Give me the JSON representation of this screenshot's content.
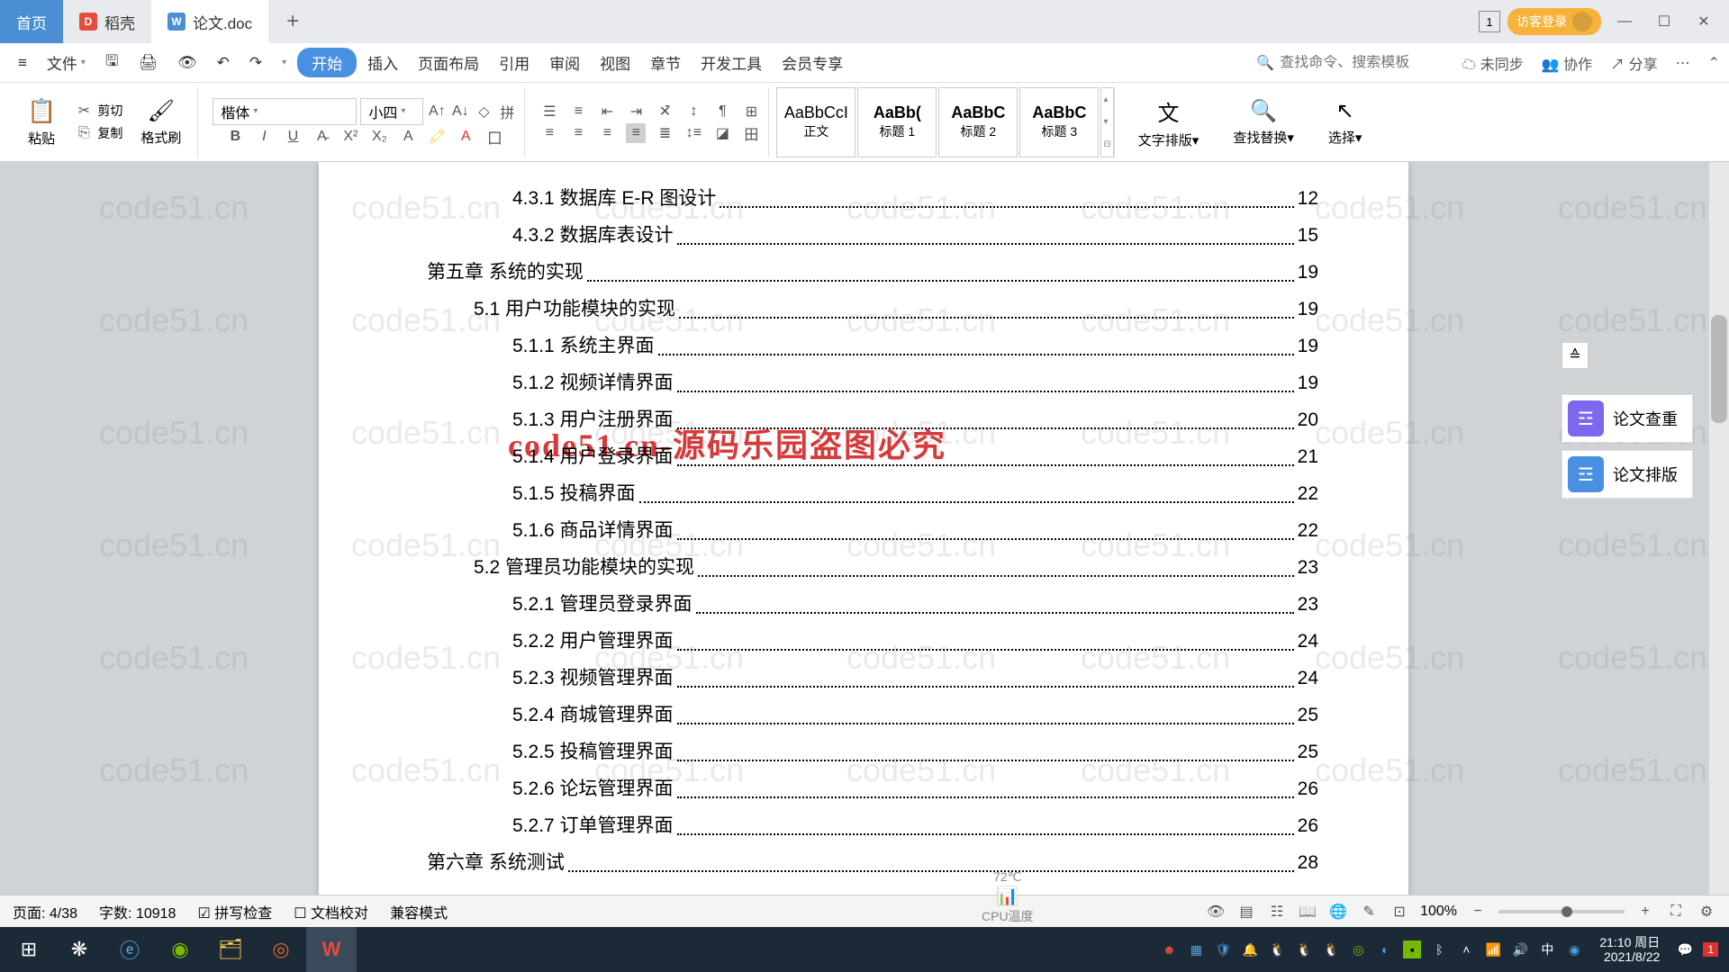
{
  "tabs": {
    "home": "首页",
    "daoke": "稻壳",
    "doc": "论文.doc"
  },
  "titlebar": {
    "box_num": "1",
    "login": "访客登录"
  },
  "menubar": {
    "file": "文件",
    "items": [
      "开始",
      "插入",
      "页面布局",
      "引用",
      "审阅",
      "视图",
      "章节",
      "开发工具",
      "会员专享"
    ],
    "search_placeholder": "查找命令、搜索模板",
    "unsync": "未同步",
    "collab": "协作",
    "share": "分享"
  },
  "ribbon": {
    "paste": "粘贴",
    "cut": "剪切",
    "copy": "复制",
    "format_painter": "格式刷",
    "font_name": "楷体",
    "font_size": "小四",
    "styles": [
      {
        "preview": "AaBbCcI",
        "label": "正文"
      },
      {
        "preview": "AaBb(",
        "label": "标题 1"
      },
      {
        "preview": "AaBbC",
        "label": "标题 2"
      },
      {
        "preview": "AaBbC",
        "label": "标题 3"
      }
    ],
    "text_layout": "文字排版",
    "find_replace": "查找替换",
    "select": "选择"
  },
  "sidepanel": {
    "check": "论文查重",
    "layout": "论文排版"
  },
  "toc": [
    {
      "lvl": 2,
      "t": "4.3.1 数据库 E-R 图设计",
      "p": "12"
    },
    {
      "lvl": 2,
      "t": "4.3.2 数据库表设计",
      "p": "15"
    },
    {
      "lvl": 0,
      "t": "第五章  系统的实现",
      "p": "19"
    },
    {
      "lvl": 1,
      "t": "5.1  用户功能模块的实现",
      "p": "19"
    },
    {
      "lvl": 2,
      "t": "5.1.1 系统主界面",
      "p": "19"
    },
    {
      "lvl": 2,
      "t": "5.1.2 视频详情界面",
      "p": "19"
    },
    {
      "lvl": 2,
      "t": "5.1.3 用户注册界面",
      "p": "20"
    },
    {
      "lvl": 2,
      "t": "5.1.4 用户登录界面",
      "p": "21"
    },
    {
      "lvl": 2,
      "t": "5.1.5 投稿界面",
      "p": "22"
    },
    {
      "lvl": 2,
      "t": "5.1.6 商品详情界面",
      "p": "22"
    },
    {
      "lvl": 1,
      "t": "5.2  管理员功能模块的实现",
      "p": "23"
    },
    {
      "lvl": 2,
      "t": "5.2.1 管理员登录界面",
      "p": "23"
    },
    {
      "lvl": 2,
      "t": "5.2.2 用户管理界面",
      "p": "24"
    },
    {
      "lvl": 2,
      "t": "5.2.3 视频管理界面",
      "p": "24"
    },
    {
      "lvl": 2,
      "t": "5.2.4 商城管理界面",
      "p": "25"
    },
    {
      "lvl": 2,
      "t": "5.2.5 投稿管理界面",
      "p": "25"
    },
    {
      "lvl": 2,
      "t": "5.2.6 论坛管理界面",
      "p": "26"
    },
    {
      "lvl": 2,
      "t": "5.2.7 订单管理界面",
      "p": "26"
    },
    {
      "lvl": 0,
      "t": "第六章  系统测试",
      "p": "28"
    }
  ],
  "watermark_text": "code51.cn",
  "red_watermark": "code51.cn-源码乐园盗图必究",
  "statusbar": {
    "page": "页面: 4/38",
    "words": "字数: 10918",
    "spell": "拼写检查",
    "docproof": "文档校对",
    "compat": "兼容模式",
    "zoom": "100%"
  },
  "cpu": {
    "temp": "72℃",
    "label": "CPU温度"
  },
  "clock": {
    "time": "21:10 周日",
    "date": "2021/8/22"
  },
  "tray_badge": "1"
}
